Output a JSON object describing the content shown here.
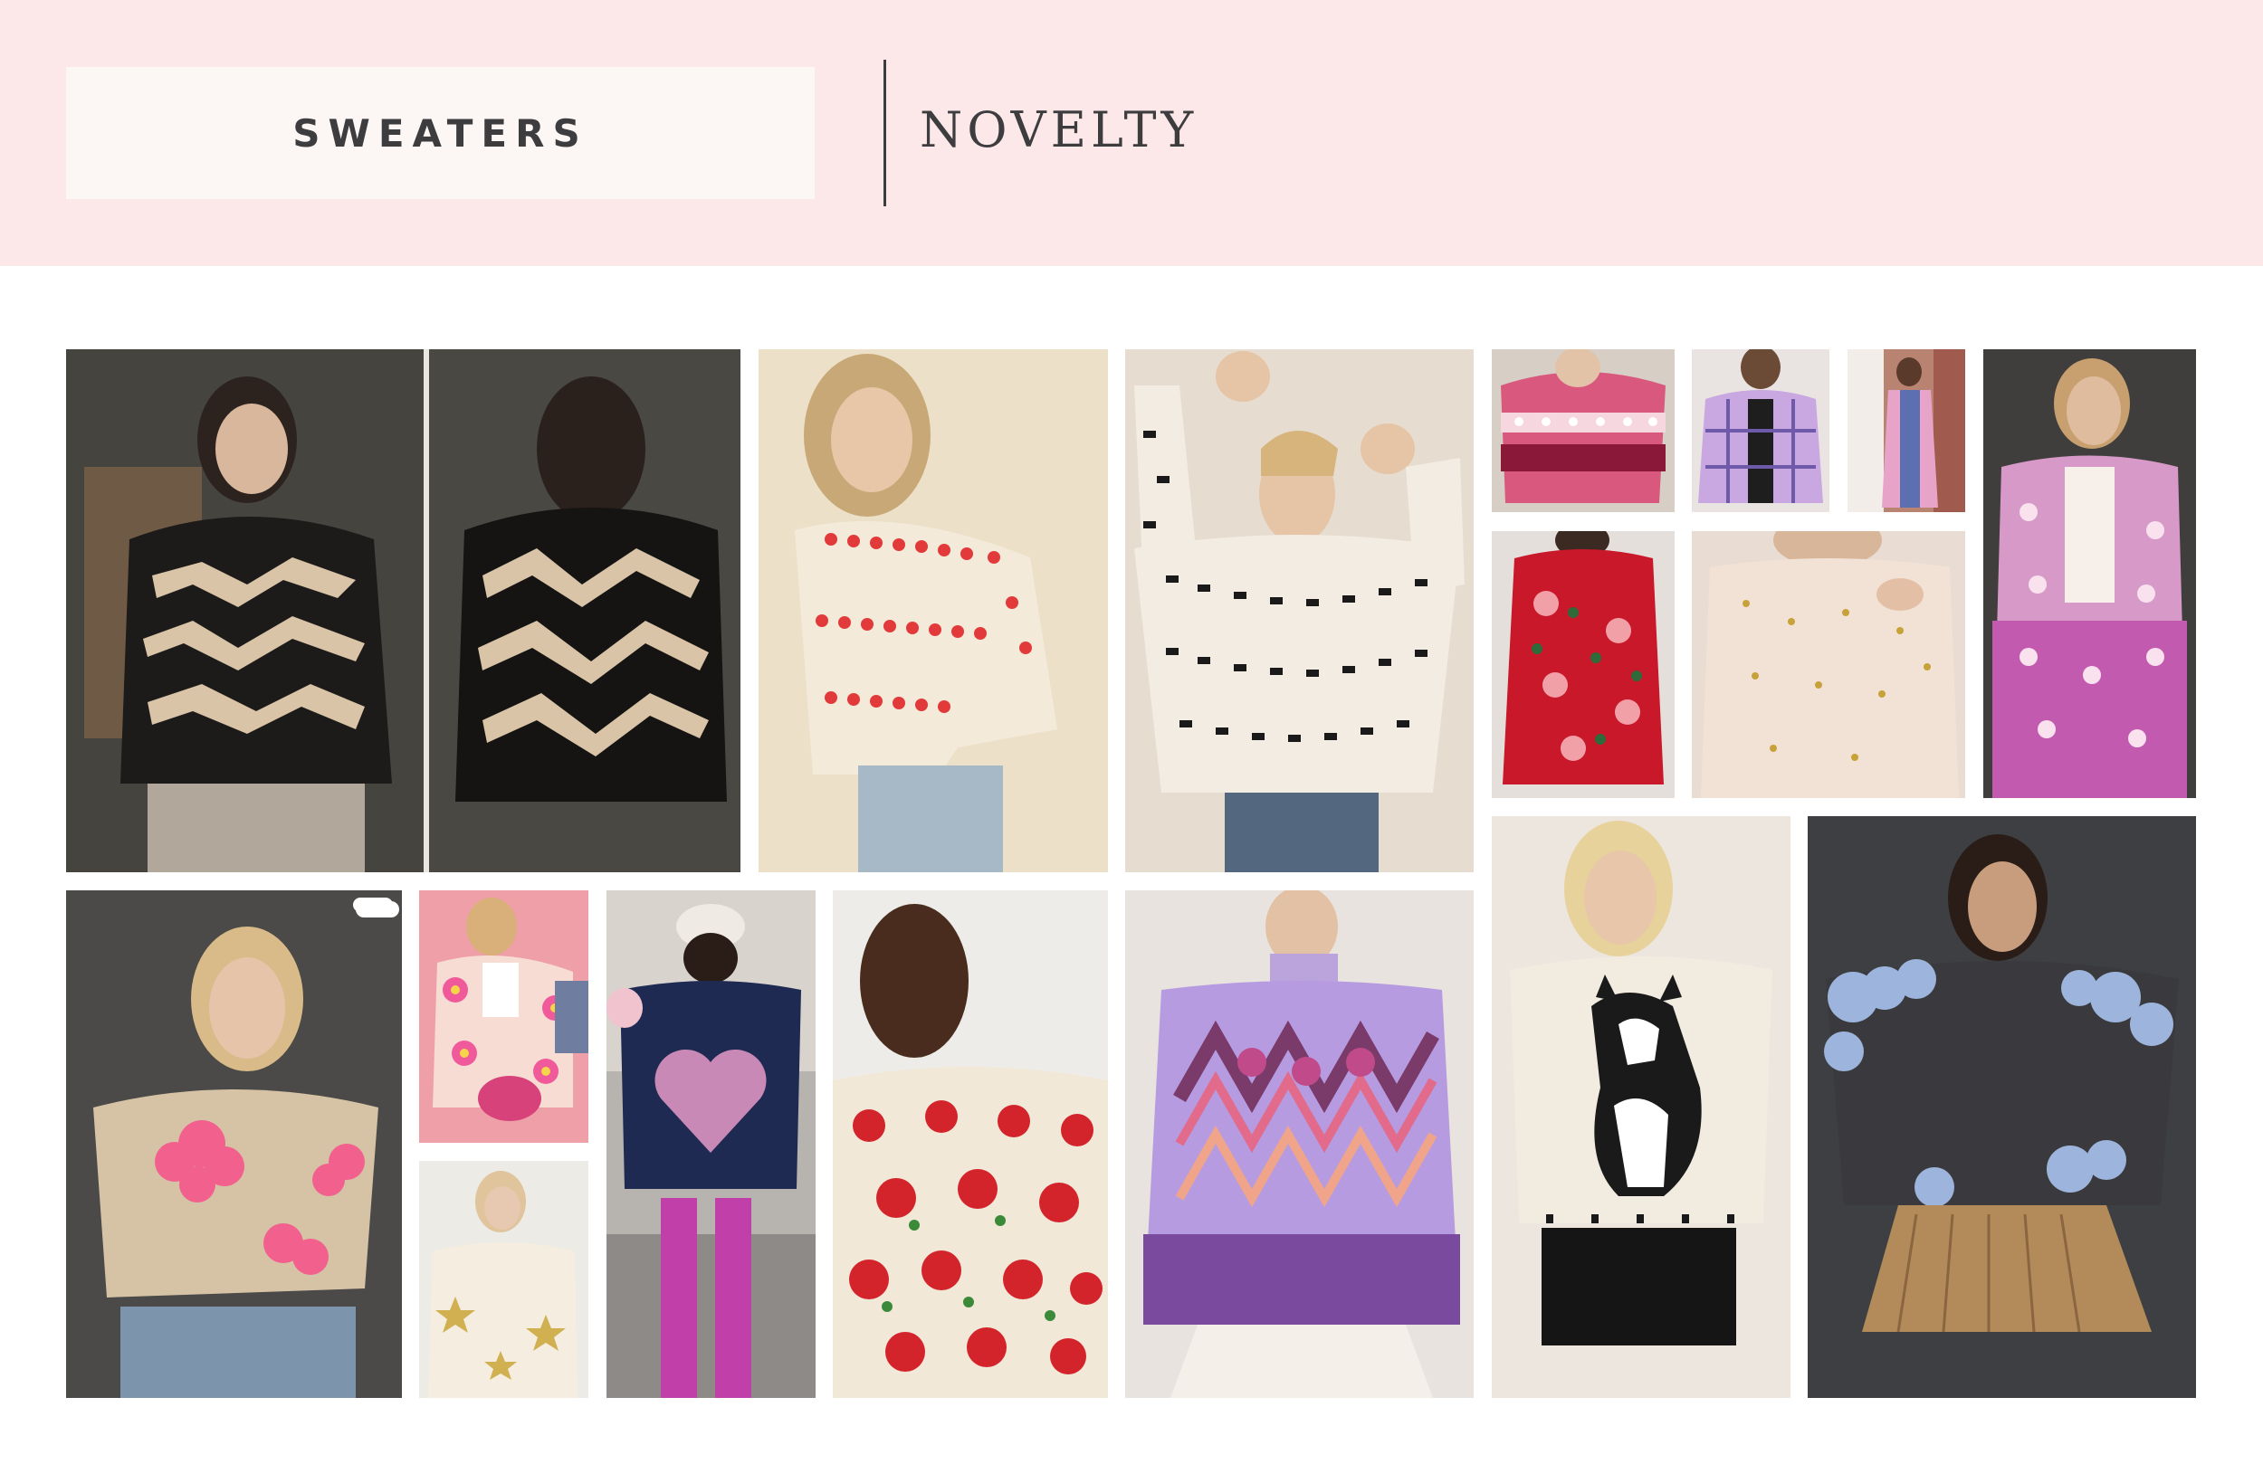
{
  "header": {
    "category": "SWEATERS",
    "subcategory": "NOVELTY"
  },
  "colors": {
    "header_background": "#fde8e9",
    "category_box": "#fcf6f5",
    "text": "#3d3d3f"
  },
  "gallery": {
    "items": [
      {
        "name": "black-zebra-turtleneck-sweater-photo",
        "description": "front and back view"
      },
      {
        "name": "cream-heart-stripe-sweater-photo"
      },
      {
        "name": "cream-black-bobble-sweater-photo"
      },
      {
        "name": "pink-heart-fairisle-sweater-photo"
      },
      {
        "name": "lilac-plaid-cardigan-photo"
      },
      {
        "name": "pink-long-cardigan-street-photo"
      },
      {
        "name": "pink-heart-long-cardigan-photo"
      },
      {
        "name": "red-rose-sweater-dress-photo"
      },
      {
        "name": "cream-polka-dot-cardigan-photo"
      },
      {
        "name": "beige-pink-flower-crop-sweater-photo"
      },
      {
        "name": "pink-flower-cardigan-photo"
      },
      {
        "name": "cream-star-sweater-photo"
      },
      {
        "name": "navy-heart-back-sweater-photo"
      },
      {
        "name": "cream-red-rose-cardigan-photo"
      },
      {
        "name": "lilac-zigzag-sweater-photo"
      },
      {
        "name": "cream-cat-sweater-photo"
      },
      {
        "name": "charcoal-blue-cloud-sweater-photo"
      }
    ]
  }
}
